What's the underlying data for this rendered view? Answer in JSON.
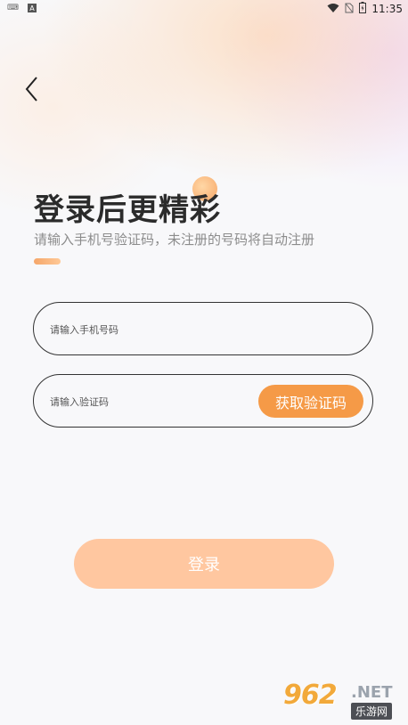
{
  "status_bar": {
    "time": "11:35",
    "left_icons": [
      "keyboard-icon",
      "a-icon"
    ],
    "right_icons": [
      "wifi-icon",
      "no-sim-icon",
      "battery-icon"
    ]
  },
  "header": {
    "back_icon": "chevron-left-icon"
  },
  "main": {
    "title": "登录后更精彩",
    "subtitle": "请输入手机号验证码，未注册的号码将自动注册",
    "phone_field": {
      "placeholder": "请输入手机号码",
      "value": ""
    },
    "code_field": {
      "placeholder": "请输入验证码",
      "value": ""
    },
    "get_code_label": "获取验证码",
    "login_label": "登录"
  },
  "watermark": {
    "number": "962",
    "domain": ".NET",
    "text": "乐游网"
  },
  "colors": {
    "accent": "#f59a47",
    "login_button": "#ffc7a0",
    "title": "#2b2b2b",
    "subtitle": "#8c8c8c"
  }
}
